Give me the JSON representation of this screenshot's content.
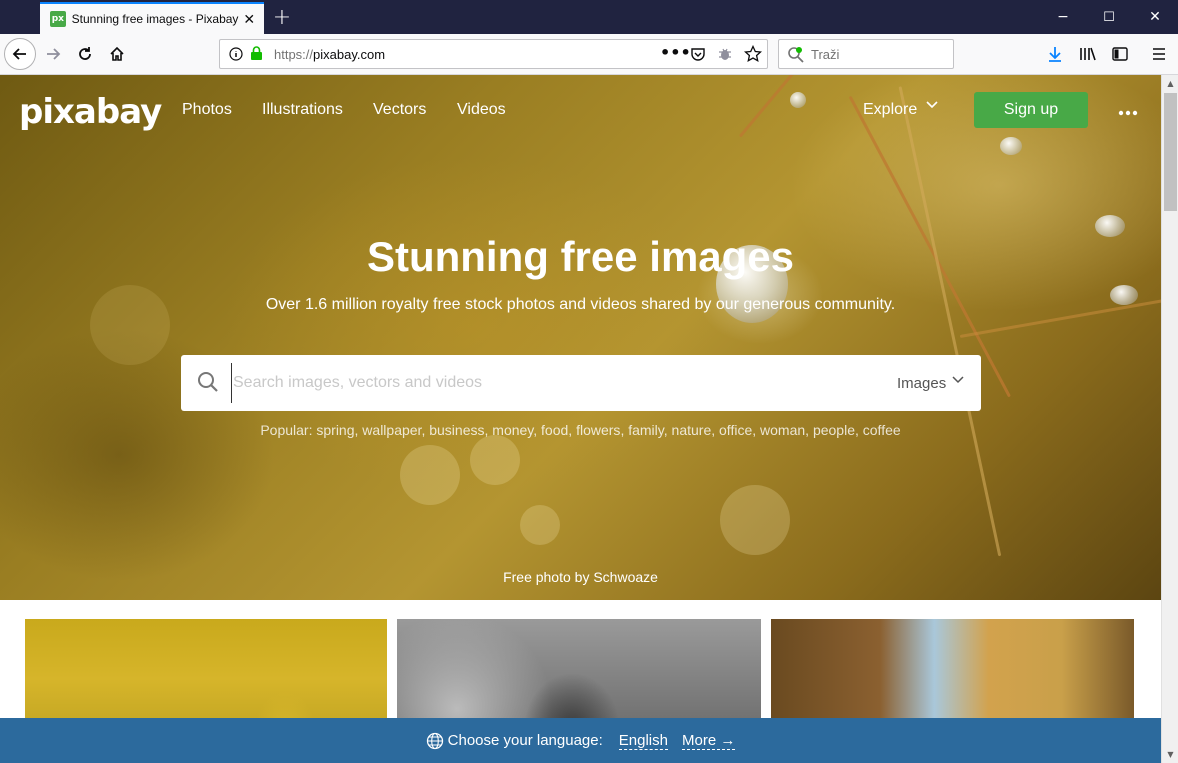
{
  "browser": {
    "tab_title": "Stunning free images - Pixabay",
    "favicon_text": "px",
    "url_prefix": "https://",
    "url_host": "pixabay.com",
    "search_placeholder": "Traži",
    "icons": {
      "back": "arrow-left-icon",
      "forward": "arrow-right-icon",
      "reload": "reload-icon",
      "home": "home-icon",
      "info": "info-icon",
      "lock": "lock-icon",
      "page_actions": "ellipsis-icon",
      "pocket": "pocket-icon",
      "tracking": "bug-icon",
      "bookmark": "star-icon",
      "download": "download-icon",
      "library": "library-icon",
      "sidebar": "sidebar-icon",
      "menu": "hamburger-icon"
    },
    "window_controls": [
      "−",
      "☐",
      "✕"
    ]
  },
  "site": {
    "logo": "pixabay",
    "nav": [
      "Photos",
      "Illustrations",
      "Vectors",
      "Videos"
    ],
    "explore": "Explore",
    "signup": "Sign up",
    "hero_title": "Stunning free images",
    "hero_subtitle": "Over 1.6 million royalty free stock photos and videos shared by our generous community.",
    "search_placeholder": "Search images, vectors and videos",
    "search_type": "Images",
    "popular_label": "Popular:",
    "popular_tags": [
      "spring",
      "wallpaper",
      "business",
      "money",
      "food",
      "flowers",
      "family",
      "nature",
      "office",
      "woman",
      "people",
      "coffee"
    ],
    "photo_credit": "Free photo by Schwoaze",
    "language_prompt": "Choose your language:",
    "language_current": "English",
    "language_more": "More →"
  },
  "colors": {
    "accent_green": "#48a947",
    "language_bar": "#2c6a9d",
    "titlebar": "#202340"
  }
}
